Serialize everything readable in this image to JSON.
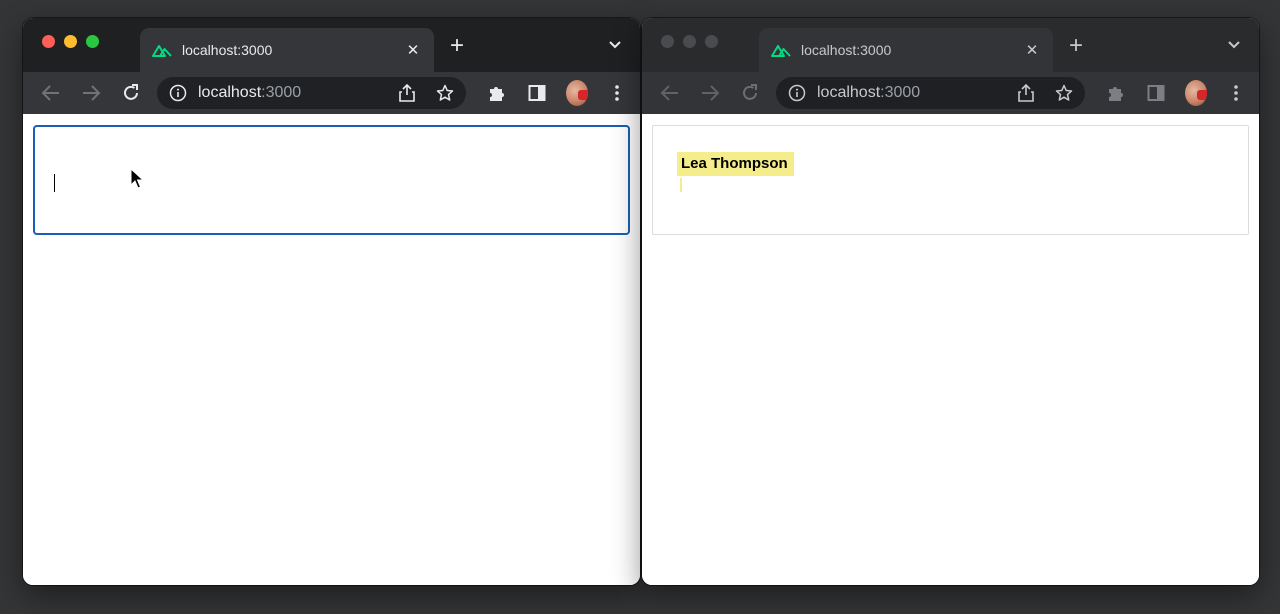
{
  "colors": {
    "tab_favicon": "#00dc82",
    "focus_border": "#1a5fb4",
    "collab_label_bg": "#f5ec8c"
  },
  "left_window": {
    "tab": {
      "title": "localhost:3000",
      "favicon": "nuxt-logo-icon"
    },
    "omnibox": {
      "host": "localhost",
      "port": ":3000"
    }
  },
  "right_window": {
    "tab": {
      "title": "localhost:3000",
      "favicon": "nuxt-logo-icon"
    },
    "omnibox": {
      "host": "localhost",
      "port": ":3000"
    },
    "collaborator_label": "Lea Thompson"
  },
  "icons": {
    "back": "arrow-left-icon",
    "forward": "arrow-right-icon",
    "reload": "reload-icon",
    "info": "info-icon",
    "share": "share-icon",
    "bookmark": "star-icon",
    "extensions": "puzzle-icon",
    "sidepanel": "side-panel-icon",
    "menu": "kebab-menu-icon"
  }
}
